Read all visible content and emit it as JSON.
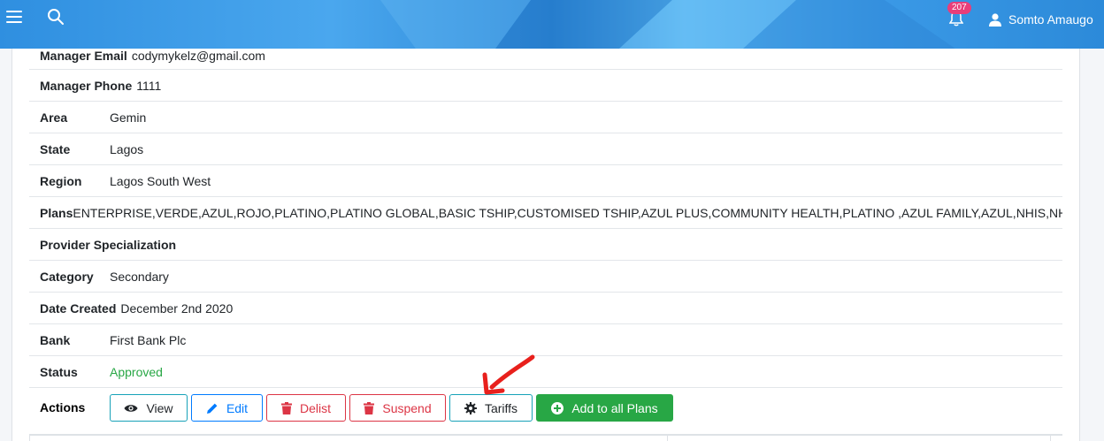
{
  "header": {
    "notification_count": "207",
    "user_name": "Somto Amaugo"
  },
  "details": {
    "manager_email": {
      "label": "Manager Email",
      "value": "codymykelz@gmail.com"
    },
    "manager_phone": {
      "label": "Manager Phone",
      "value": "1111"
    },
    "area": {
      "label": "Area",
      "value": "Gemin"
    },
    "state": {
      "label": "State",
      "value": "Lagos"
    },
    "region": {
      "label": "Region",
      "value": "Lagos South West"
    },
    "plans": {
      "label": "Plans",
      "value": "ENTERPRISE,VERDE,AZUL,ROJO,PLATINO,PLATINO GLOBAL,BASIC TSHIP,CUSTOMISED TSHIP,AZUL PLUS,COMMUNITY HEALTH,PLATINO ,AZUL FAMILY,AZUL,NHIS,NHA RE"
    },
    "provider_specialization": {
      "label": "Provider Specialization",
      "value": ""
    },
    "category": {
      "label": "Category",
      "value": "Secondary"
    },
    "date_created": {
      "label": "Date Created",
      "value": "December 2nd 2020"
    },
    "bank": {
      "label": "Bank",
      "value": "First Bank Plc"
    },
    "status": {
      "label": "Status",
      "value": "Approved",
      "color": "#28a745"
    }
  },
  "actions": {
    "label": "Actions",
    "view": "View",
    "edit": "Edit",
    "delist": "Delist",
    "suspend": "Suspend",
    "tariffs": "Tariffs",
    "add_to_all_plans": "Add to all Plans"
  },
  "colors": {
    "info": "#17a2b8",
    "primary": "#007bff",
    "danger": "#dc3545",
    "success": "#28a745",
    "annotation": "#e8201c"
  }
}
